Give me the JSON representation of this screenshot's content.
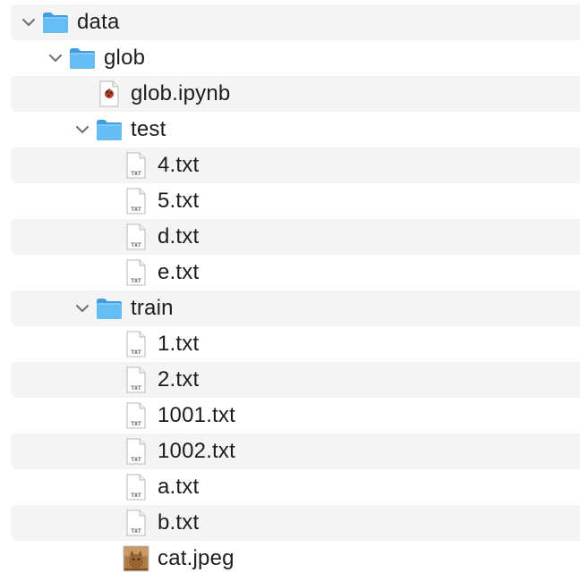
{
  "tree": {
    "rows": [
      {
        "label": "data",
        "kind": "folder",
        "expanded": true,
        "depth": 0
      },
      {
        "label": "glob",
        "kind": "folder",
        "expanded": true,
        "depth": 1
      },
      {
        "label": "glob.ipynb",
        "kind": "notebook",
        "depth": 2
      },
      {
        "label": "test",
        "kind": "folder",
        "expanded": true,
        "depth": 2
      },
      {
        "label": "4.txt",
        "kind": "txt",
        "depth": 3
      },
      {
        "label": "5.txt",
        "kind": "txt",
        "depth": 3
      },
      {
        "label": "d.txt",
        "kind": "txt",
        "depth": 3
      },
      {
        "label": "e.txt",
        "kind": "txt",
        "depth": 3
      },
      {
        "label": "train",
        "kind": "folder",
        "expanded": true,
        "depth": 2
      },
      {
        "label": "1.txt",
        "kind": "txt",
        "depth": 3
      },
      {
        "label": "2.txt",
        "kind": "txt",
        "depth": 3
      },
      {
        "label": "1001.txt",
        "kind": "txt",
        "depth": 3
      },
      {
        "label": "1002.txt",
        "kind": "txt",
        "depth": 3
      },
      {
        "label": "a.txt",
        "kind": "txt",
        "depth": 3
      },
      {
        "label": "b.txt",
        "kind": "txt",
        "depth": 3
      },
      {
        "label": "cat.jpeg",
        "kind": "image",
        "depth": 3
      }
    ]
  },
  "icons": {
    "folder": "folder-icon",
    "notebook": "notebook-icon",
    "txt": "txt-file-icon",
    "image": "image-thumbnail-icon",
    "chevron": "chevron-down-icon"
  },
  "txt_badge": "TXT",
  "colors": {
    "alt_row": "#f4f4f5",
    "folder_front": "#66bdf3",
    "folder_back": "#3f9de0",
    "text": "#1d1d1f",
    "chevron": "#6e6e73"
  }
}
